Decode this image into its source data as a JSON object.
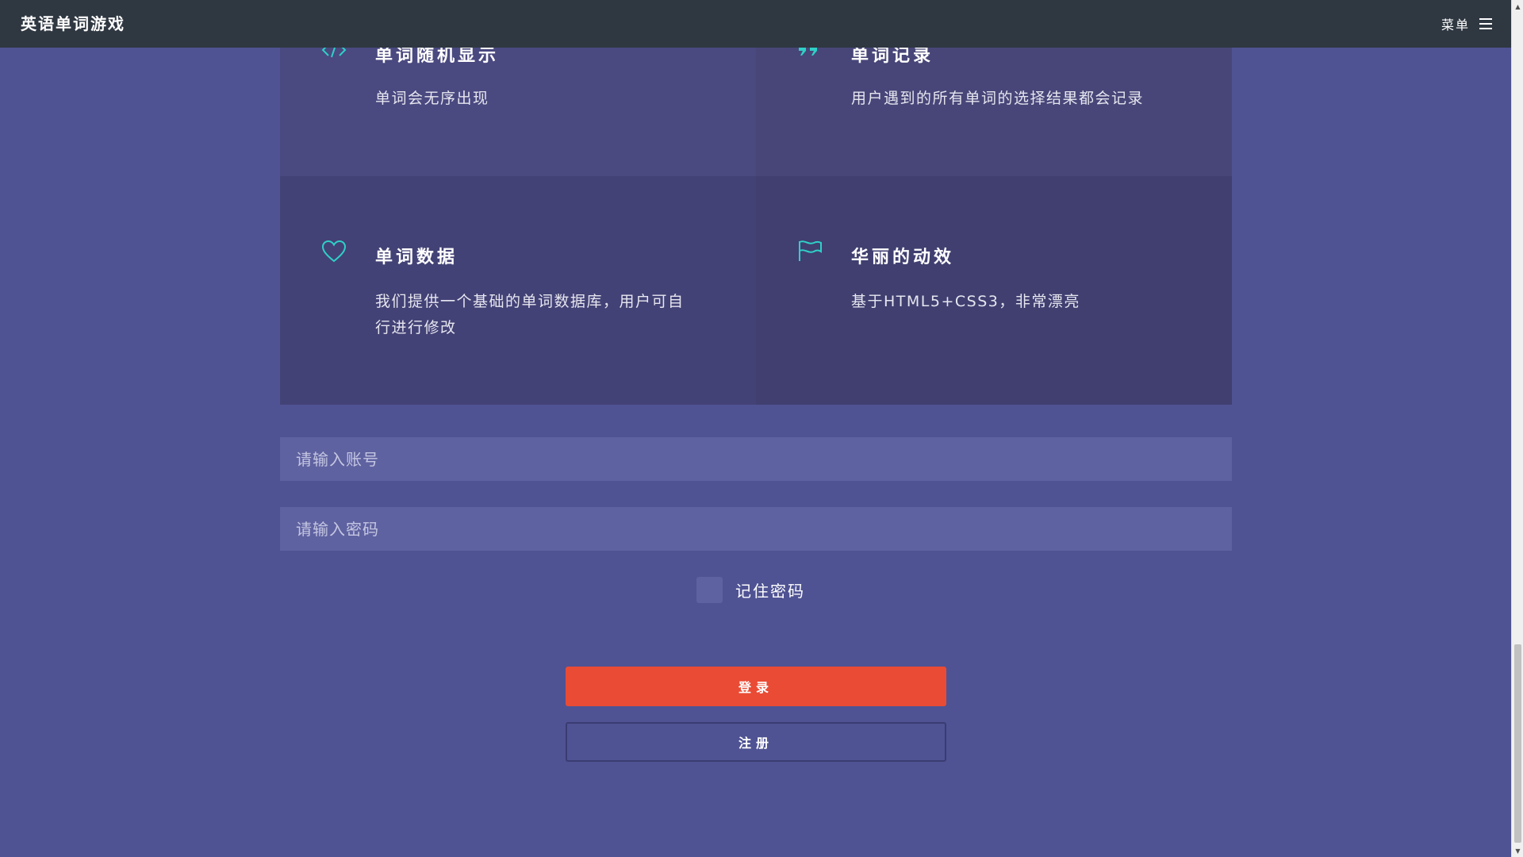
{
  "header": {
    "brand": "英语单词游戏",
    "menu_label": "菜单",
    "menu_icon": "hamburger-icon"
  },
  "features": [
    {
      "icon": "code-icon",
      "title": "单词随机显示",
      "description": "单词会无序出现"
    },
    {
      "icon": "quote-icon",
      "title": "单词记录",
      "description": "用户遇到的所有单词的选择结果都会记录"
    },
    {
      "icon": "heart-icon",
      "title": "单词数据",
      "description": "我们提供一个基础的单词数据库，用户可自行进行修改"
    },
    {
      "icon": "flag-icon",
      "title": "华丽的动效",
      "description": "基于HTML5+CSS3，非常漂亮"
    }
  ],
  "form": {
    "account_placeholder": "请输入账号",
    "password_placeholder": "请输入密码",
    "remember_label": "记住密码",
    "login_label": "登录",
    "register_label": "注册"
  },
  "colors": {
    "background": "#4f5393",
    "header": "#2f3741",
    "accent_icon": "#2fd0c6",
    "login_button": "#ea4b35"
  }
}
